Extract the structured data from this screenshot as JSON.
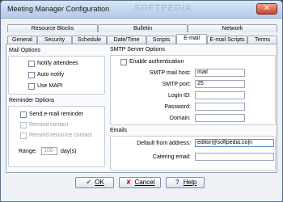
{
  "window": {
    "title": "Meeting Manager Configuration",
    "watermark": "SOFTPEDIA",
    "close": "✕"
  },
  "tabs": {
    "top": [
      "Resource Blocks",
      "Bulletin",
      "Network"
    ],
    "bottom": [
      "General",
      "Security",
      "Schedule",
      "Date/Time",
      "Scripts",
      "E-mail",
      "E-mail Scripts",
      "Terms"
    ],
    "active": "E-mail"
  },
  "mail_options": {
    "title": "Mail Options",
    "items": [
      {
        "label": "Notify attendees",
        "checked": false
      },
      {
        "label": "Auto notify",
        "checked": false
      },
      {
        "label": "Use MAPI",
        "checked": false
      }
    ]
  },
  "reminder_options": {
    "title": "Reminder Options",
    "items": [
      {
        "label": "Send e-mail reminder",
        "checked": false,
        "disabled": false
      },
      {
        "label": "Remind contact",
        "checked": false,
        "disabled": true
      },
      {
        "label": "Remind resource contact",
        "checked": false,
        "disabled": true
      }
    ],
    "range_label": "Range:",
    "range_value": "100",
    "range_unit": "day(s)"
  },
  "smtp": {
    "title": "SMTP Server Options",
    "enable_auth_label": "Enable authentication",
    "fields": [
      {
        "label": "SMTP mail host:",
        "value": "mail"
      },
      {
        "label": "SMTP port:",
        "value": "25"
      },
      {
        "label": "Login ID:",
        "value": ""
      },
      {
        "label": "Password:",
        "value": ""
      },
      {
        "label": "Domain:",
        "value": ""
      }
    ]
  },
  "emails": {
    "title": "Emails",
    "default_from_label": "Default from address:",
    "default_from_value": "editor@softpedia.co|n",
    "catering_label": "Catering email:",
    "catering_value": ""
  },
  "buttons": {
    "ok": "OK",
    "cancel": "Cancel",
    "help": "Help",
    "ok_icon": "✔",
    "cancel_icon": "✘",
    "help_icon": "?"
  },
  "colors": {
    "ok_icon": "#2e8b2e",
    "cancel_icon": "#c0281f",
    "help_icon": "#2a5fb8"
  }
}
